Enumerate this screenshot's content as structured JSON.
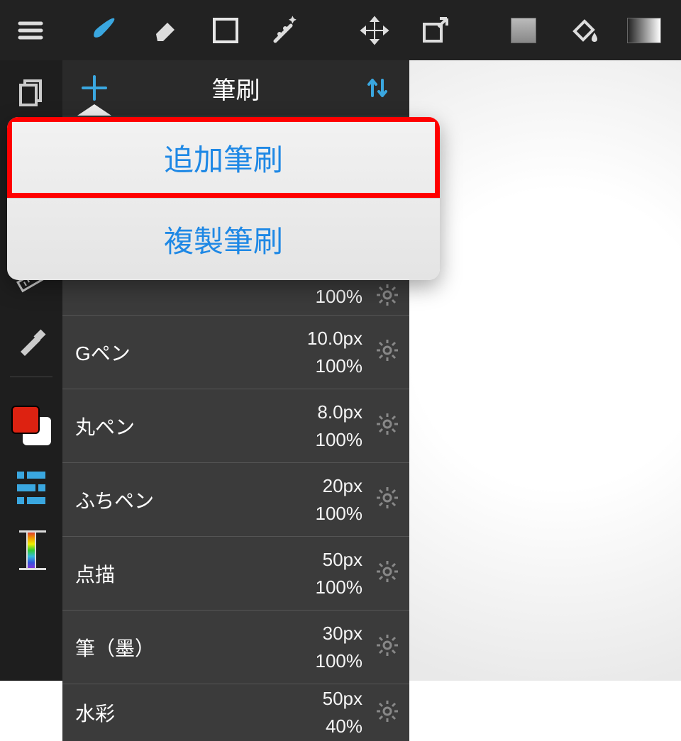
{
  "panel": {
    "title": "筆刷"
  },
  "popup": {
    "add": "追加筆刷",
    "duplicate": "複製筆刷"
  },
  "brushes": [
    {
      "name": "",
      "size": "",
      "opacity": "100%"
    },
    {
      "name": "Gペン",
      "size": "10.0px",
      "opacity": "100%"
    },
    {
      "name": "丸ペン",
      "size": "8.0px",
      "opacity": "100%"
    },
    {
      "name": "ふちペン",
      "size": "20px",
      "opacity": "100%"
    },
    {
      "name": "点描",
      "size": "50px",
      "opacity": "100%"
    },
    {
      "name": "筆（墨）",
      "size": "30px",
      "opacity": "100%"
    },
    {
      "name": "水彩",
      "size": "50px",
      "opacity": "40%"
    }
  ]
}
